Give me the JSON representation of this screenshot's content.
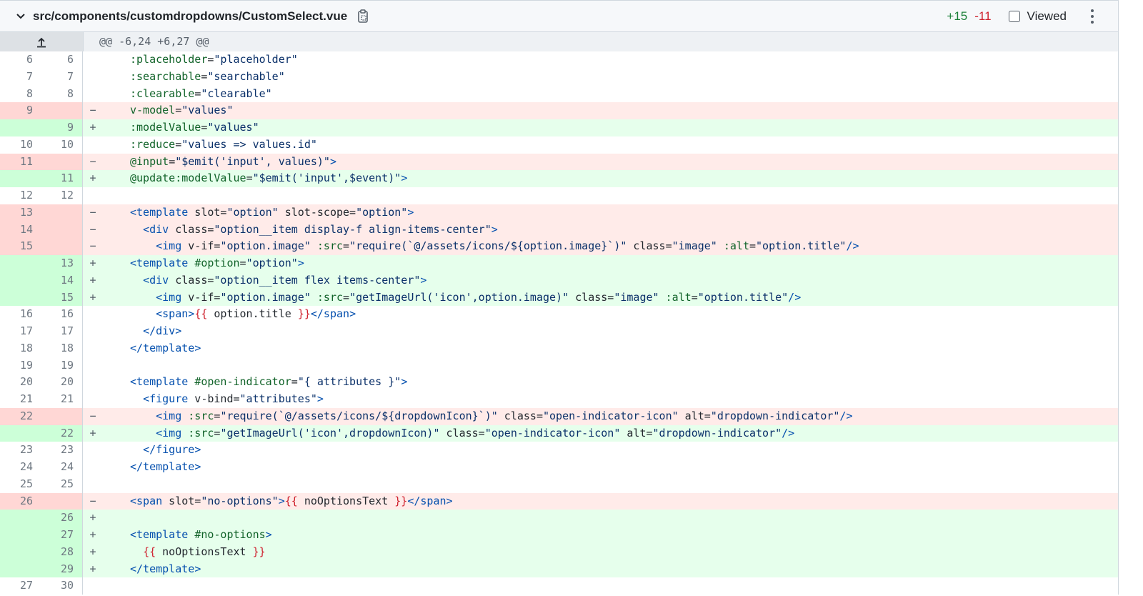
{
  "header": {
    "file_path": "src/components/customdropdowns/CustomSelect.vue",
    "additions": "+15",
    "deletions": "-11",
    "viewed_label": "Viewed"
  },
  "hunk": {
    "text": "@@ -6,24 +6,27 @@"
  },
  "lines": [
    {
      "type": "ctx",
      "old": "6",
      "new": "6",
      "sign": "",
      "code": ":placeholder=\"placeholder\""
    },
    {
      "type": "ctx",
      "old": "7",
      "new": "7",
      "sign": "",
      "code": ":searchable=\"searchable\""
    },
    {
      "type": "ctx",
      "old": "8",
      "new": "8",
      "sign": "",
      "code": ":clearable=\"clearable\""
    },
    {
      "type": "del",
      "old": "9",
      "new": "",
      "sign": "−",
      "code": "v-model=\"values\""
    },
    {
      "type": "add",
      "old": "",
      "new": "9",
      "sign": "+",
      "code": ":modelValue=\"values\""
    },
    {
      "type": "ctx",
      "old": "10",
      "new": "10",
      "sign": "",
      "code": ":reduce=\"values => values.id\""
    },
    {
      "type": "del",
      "old": "11",
      "new": "",
      "sign": "−",
      "code": "@input=\"$emit('input', values)\">"
    },
    {
      "type": "add",
      "old": "",
      "new": "11",
      "sign": "+",
      "code": "@update:modelValue=\"$emit('input',$event)\">"
    },
    {
      "type": "ctx",
      "old": "12",
      "new": "12",
      "sign": "",
      "code": ""
    },
    {
      "type": "del",
      "old": "13",
      "new": "",
      "sign": "−",
      "code": "<template slot=\"option\" slot-scope=\"option\">"
    },
    {
      "type": "del",
      "old": "14",
      "new": "",
      "sign": "−",
      "code": "  <div class=\"option__item display-f align-items-center\">"
    },
    {
      "type": "del",
      "old": "15",
      "new": "",
      "sign": "−",
      "code": "    <img v-if=\"option.image\" :src=\"require(`@/assets/icons/${option.image}`)\" class=\"image\" :alt=\"option.title\"/>"
    },
    {
      "type": "add",
      "old": "",
      "new": "13",
      "sign": "+",
      "code": "<template #option=\"option\">"
    },
    {
      "type": "add",
      "old": "",
      "new": "14",
      "sign": "+",
      "code": "  <div class=\"option__item flex items-center\">"
    },
    {
      "type": "add",
      "old": "",
      "new": "15",
      "sign": "+",
      "code": "    <img v-if=\"option.image\" :src=\"getImageUrl('icon',option.image)\" class=\"image\" :alt=\"option.title\"/>"
    },
    {
      "type": "ctx",
      "old": "16",
      "new": "16",
      "sign": "",
      "code": "    <span>{{ option.title }}</span>"
    },
    {
      "type": "ctx",
      "old": "17",
      "new": "17",
      "sign": "",
      "code": "  </div>"
    },
    {
      "type": "ctx",
      "old": "18",
      "new": "18",
      "sign": "",
      "code": "</template>"
    },
    {
      "type": "ctx",
      "old": "19",
      "new": "19",
      "sign": "",
      "code": ""
    },
    {
      "type": "ctx",
      "old": "20",
      "new": "20",
      "sign": "",
      "code": "<template #open-indicator=\"{ attributes }\">"
    },
    {
      "type": "ctx",
      "old": "21",
      "new": "21",
      "sign": "",
      "code": "  <figure v-bind=\"attributes\">"
    },
    {
      "type": "del",
      "old": "22",
      "new": "",
      "sign": "−",
      "code": "    <img :src=\"require(`@/assets/icons/${dropdownIcon}`)\" class=\"open-indicator-icon\" alt=\"dropdown-indicator\"/>"
    },
    {
      "type": "add",
      "old": "",
      "new": "22",
      "sign": "+",
      "code": "    <img :src=\"getImageUrl('icon',dropdownIcon)\" class=\"open-indicator-icon\" alt=\"dropdown-indicator\"/>"
    },
    {
      "type": "ctx",
      "old": "23",
      "new": "23",
      "sign": "",
      "code": "  </figure>"
    },
    {
      "type": "ctx",
      "old": "24",
      "new": "24",
      "sign": "",
      "code": "</template>"
    },
    {
      "type": "ctx",
      "old": "25",
      "new": "25",
      "sign": "",
      "code": ""
    },
    {
      "type": "del",
      "old": "26",
      "new": "",
      "sign": "−",
      "code": "<span slot=\"no-options\">{{ noOptionsText }}</span>"
    },
    {
      "type": "add",
      "old": "",
      "new": "26",
      "sign": "+",
      "code": ""
    },
    {
      "type": "add",
      "old": "",
      "new": "27",
      "sign": "+",
      "code": "<template #no-options>"
    },
    {
      "type": "add",
      "old": "",
      "new": "28",
      "sign": "+",
      "code": "  {{ noOptionsText }}"
    },
    {
      "type": "add",
      "old": "",
      "new": "29",
      "sign": "+",
      "code": "</template>"
    },
    {
      "type": "ctx",
      "old": "27",
      "new": "30",
      "sign": "",
      "code": ""
    }
  ],
  "colors": {
    "added": "#1a7f37",
    "deleted": "#cf222e",
    "add_bg": "#e6ffec",
    "del_bg": "#ffebe9"
  }
}
